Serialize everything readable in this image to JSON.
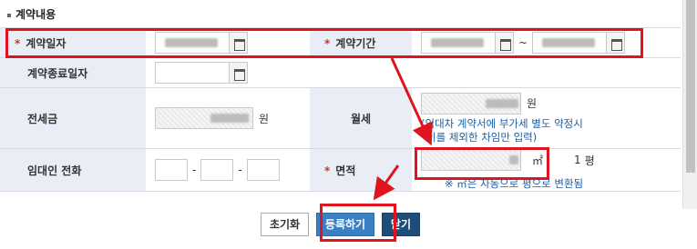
{
  "section": {
    "title": "계약내용"
  },
  "rows": {
    "contract_date": {
      "label": "계약일자"
    },
    "contract_period": {
      "label": "계약기간"
    },
    "contract_end_date": {
      "label": "계약종료일자"
    },
    "deposit": {
      "label": "전세금",
      "unit": "원"
    },
    "monthly_rent": {
      "label": "월세",
      "unit": "원",
      "note_line1": "(임대차 계약서에 부가세 별도 약정시",
      "note_line2": "이를 제외한 차임만 입력)"
    },
    "tenant_phone": {
      "label": "임대인 전화",
      "sep": "-"
    },
    "area": {
      "label": "면적",
      "unit": "㎡",
      "pyeong_value": "1",
      "pyeong_unit": "평",
      "note": "※ ㎡은 자동으로 평으로 변환됨"
    }
  },
  "buttons": {
    "reset": "초기화",
    "submit": "등록하기",
    "close": "닫기"
  },
  "colors": {
    "highlight": "#e0141e",
    "header_bg": "#e9eef6",
    "note_blue": "#1a5fa8",
    "submit_bg": "#3b7fc4",
    "close_bg": "#1f4d7a"
  }
}
